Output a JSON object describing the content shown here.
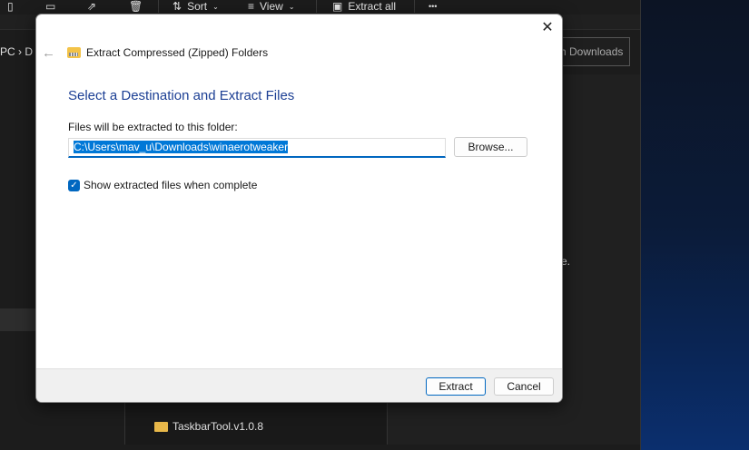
{
  "toolbar": {
    "sort": "Sort",
    "view": "View",
    "extract_all": "Extract all",
    "more": "•••"
  },
  "explorer": {
    "breadcrumb": "PC › D",
    "search_placeholder": "h Downloads",
    "partial_text": "e.",
    "files": [
      "TaskbarTool.v1.0.8"
    ]
  },
  "dialog": {
    "title": "Extract Compressed (Zipped) Folders",
    "heading": "Select a Destination and Extract Files",
    "path_label": "Files will be extracted to this folder:",
    "path_value": "C:\\Users\\mav_u\\Downloads\\winaerotweaker",
    "browse": "Browse...",
    "checkbox_label": "Show extracted files when complete",
    "checkbox_checked": true,
    "extract": "Extract",
    "cancel": "Cancel",
    "close": "✕",
    "back": "←"
  },
  "colors": {
    "accent": "#0067c0",
    "heading": "#1c3f94"
  }
}
